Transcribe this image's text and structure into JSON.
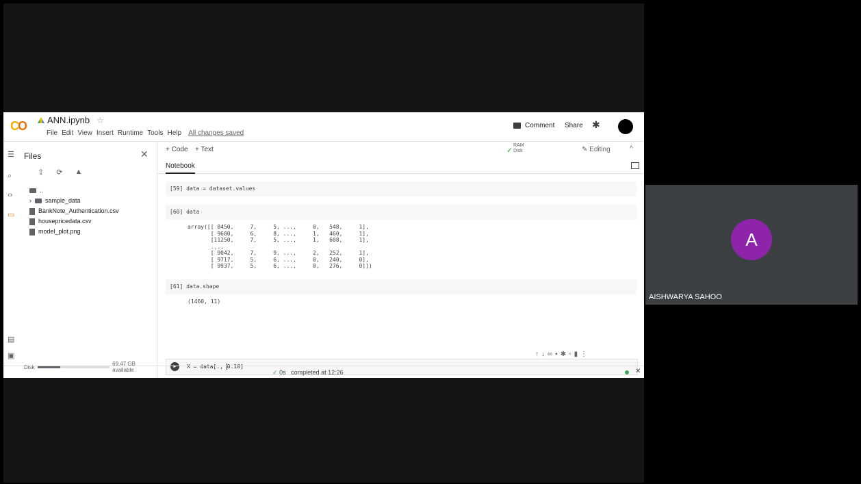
{
  "colab": {
    "logo": "CO",
    "notebook_name": "ANN.ipynb",
    "menu": [
      "File",
      "Edit",
      "View",
      "Insert",
      "Runtime",
      "Tools",
      "Help"
    ],
    "saved_status": "All changes saved",
    "comment_label": "Comment",
    "share_label": "Share",
    "ram_label": "RAM",
    "disk_label": "Disk",
    "editing_label": "Editing",
    "add_code": "+ Code",
    "add_text": "+ Text",
    "tab": "Notebook"
  },
  "sidebar": {
    "title": "Files",
    "tree": [
      {
        "name": "..",
        "kind": "folder"
      },
      {
        "name": "sample_data",
        "kind": "folder"
      },
      {
        "name": "BankNote_Authentication.csv",
        "kind": "file"
      },
      {
        "name": "housepricedata.csv",
        "kind": "file"
      },
      {
        "name": "model_plot.png",
        "kind": "file"
      }
    ],
    "disk_label": "Disk",
    "disk_available": "69.47 GB available",
    "disk_fraction": 0.32
  },
  "cells": [
    {
      "code": "[59] data = dataset.values",
      "output": ""
    },
    {
      "code": "[60] data",
      "output": "array([[ 8450,     7,     5, ...,     0,   548,     1],\n       [ 9600,     6,     8, ...,     1,   460,     1],\n       [11250,     7,     5, ...,     1,   608,     1],\n       ...,\n       [ 9042,     7,     9, ...,     2,   252,     1],\n       [ 9717,     5,     6, ...,     0,   240,     0],\n       [ 9937,     5,     6, ...,     0,   276,     0]])"
    },
    {
      "code": "[61] data.shape",
      "output": "(1460, 11)"
    }
  ],
  "active_cell": {
    "before_cursor": "X = data[:, ",
    "after_cursor": "0:10]"
  },
  "status": {
    "time": "0s",
    "completed": "completed at 12:26"
  },
  "participant": {
    "initial": "A",
    "name": "AISHWARYA SAHOO"
  }
}
